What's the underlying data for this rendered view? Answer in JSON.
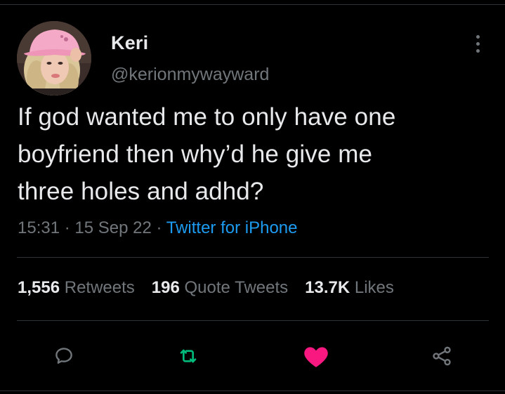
{
  "tweet": {
    "author": {
      "display_name": "Keri",
      "handle": "@kerionmywayward"
    },
    "text_lines": [
      "If god wanted me to only have one",
      "boyfriend then why’d he give me",
      "three holes and adhd?"
    ],
    "meta": {
      "time": "15:31",
      "date": "15 Sep 22",
      "source": "Twitter for iPhone",
      "separator": " · "
    },
    "stats": {
      "retweets_count": "1,556",
      "retweets_label": "Retweets",
      "quote_tweets_count": "196",
      "quote_tweets_label": "Quote Tweets",
      "likes_count": "13.7K",
      "likes_label": "Likes"
    },
    "actions": {
      "reply_icon": "reply-bubble-icon",
      "retweet_icon": "retweet-icon",
      "like_icon": "heart-icon",
      "share_icon": "share-icon"
    }
  },
  "colors": {
    "background": "#000000",
    "text_primary": "#e7e9ea",
    "text_secondary": "#71767b",
    "link": "#1d9bf0",
    "retweet_green": "#00ba7c",
    "like_pink": "#f91880",
    "divider": "#2f3336"
  }
}
